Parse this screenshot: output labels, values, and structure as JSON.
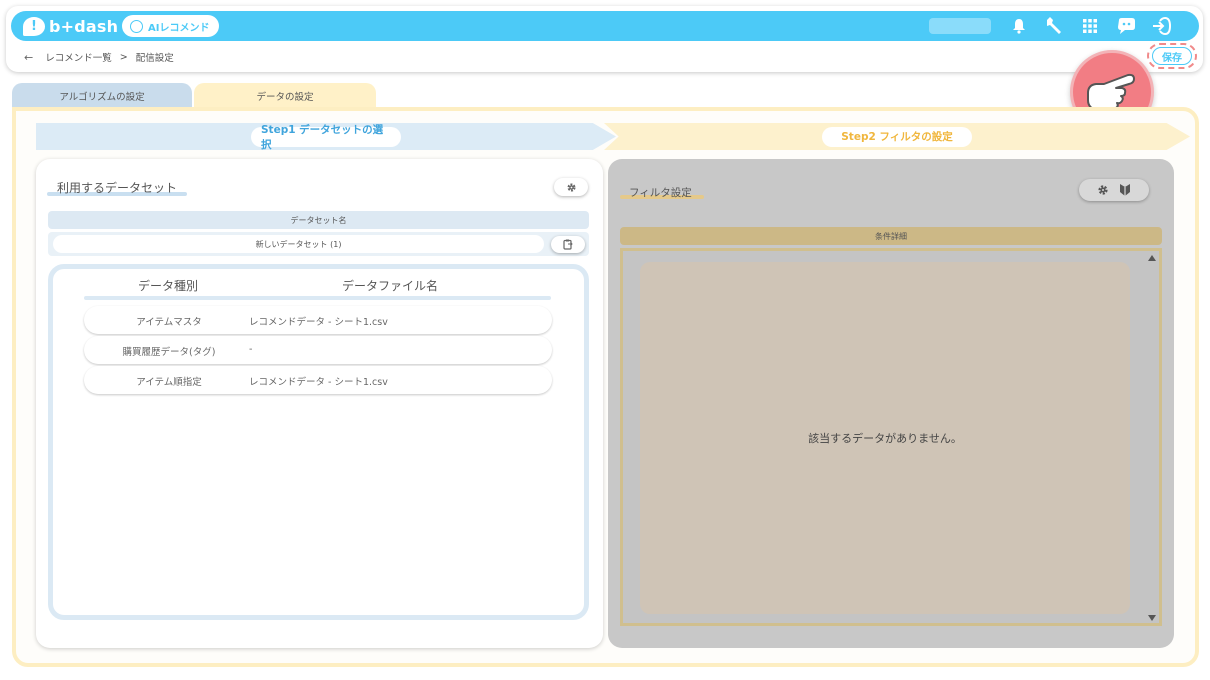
{
  "header": {
    "logo_glyph": "!",
    "logo_text": "b+dash",
    "product_label": "AIレコメンド",
    "icons": [
      "bell-icon",
      "wrench-icon",
      "grid-icon",
      "chat-icon",
      "logout-icon"
    ]
  },
  "breadcrumb": {
    "back": "←",
    "parent": "レコメンド一覧",
    "separator": ">",
    "current": "配信設定"
  },
  "save_button": "保存",
  "tabs": [
    {
      "label": "アルゴリズムの設定",
      "active": false
    },
    {
      "label": "データの設定",
      "active": true
    }
  ],
  "steps": {
    "step1": "Step1 データセットの選択",
    "step2": "Step2 フィルタの設定"
  },
  "dataset_panel": {
    "title": "利用するデータセット",
    "table_header": "データセット名",
    "dataset_name": "新しいデータセット (1)",
    "columns": [
      "データ種別",
      "データファイル名"
    ],
    "rows": [
      {
        "type": "アイテムマスタ",
        "file": "レコメンドデータ - シート1.csv"
      },
      {
        "type": "購買履歴データ(タグ)",
        "file": "-"
      },
      {
        "type": "アイテム順指定",
        "file": "レコメンドデータ - シート1.csv"
      }
    ]
  },
  "filter_panel": {
    "title": "フィルタ設定",
    "table_header": "条件詳細",
    "empty_message": "該当するデータがありません。"
  },
  "colors": {
    "accent": "#4ccaf7",
    "step1": "#dcebf6",
    "step2": "#fdf1cd",
    "highlight": "#f27d84"
  }
}
